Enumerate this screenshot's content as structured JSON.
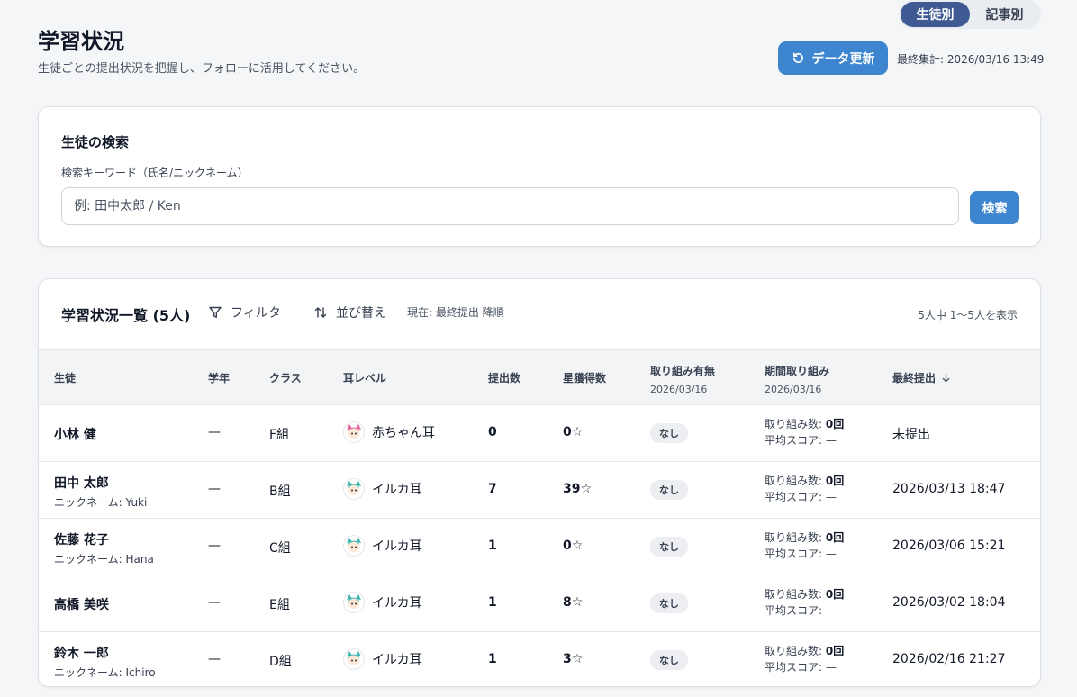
{
  "view_toggle": {
    "by_student": "生徒別",
    "by_article": "記事別",
    "active": "by_student"
  },
  "header": {
    "title": "学習状況",
    "subtitle": "生徒ごとの提出状況を把握し、フォローに活用してください。",
    "refresh_label": "データ更新",
    "last_aggregated": "最終集計: 2026/03/16 13:49"
  },
  "search": {
    "title": "生徒の検索",
    "label": "検索キーワード（氏名/ニックネーム）",
    "placeholder": "例: 田中太郎 / Ken",
    "value": "",
    "button": "検索"
  },
  "list": {
    "title": "学習状況一覧 (5人)",
    "filter_label": "フィルタ",
    "sort_label": "並び替え",
    "sort_current": "現在: 最終提出 降順",
    "count_info": "5人中 1〜5人を表示",
    "columns": {
      "student": "生徒",
      "grade": "学年",
      "class": "クラス",
      "ear_level": "耳レベル",
      "submissions": "提出数",
      "stars": "星獲得数",
      "engagement": "取り組み有無",
      "engagement_date": "2026/03/16",
      "period": "期間取り組み",
      "period_date": "2026/03/16",
      "last_submit": "最終提出"
    },
    "rows": [
      {
        "name": "小林 健",
        "nickname": "",
        "grade": "—",
        "class": "F組",
        "ear": "赤ちゃん耳",
        "ear_type": "pink",
        "submissions": "0",
        "stars": "0☆",
        "engagement": "なし",
        "act_count_label": "取り組み数:",
        "act_count": "0回",
        "avg_label": "平均スコア:",
        "avg": "—",
        "last_submit": "未提出"
      },
      {
        "name": "田中 太郎",
        "nickname": "ニックネーム: Yuki",
        "grade": "—",
        "class": "B組",
        "ear": "イルカ耳",
        "ear_type": "teal",
        "submissions": "7",
        "stars": "39☆",
        "engagement": "なし",
        "act_count_label": "取り組み数:",
        "act_count": "0回",
        "avg_label": "平均スコア:",
        "avg": "—",
        "last_submit": "2026/03/13 18:47"
      },
      {
        "name": "佐藤 花子",
        "nickname": "ニックネーム: Hana",
        "grade": "—",
        "class": "C組",
        "ear": "イルカ耳",
        "ear_type": "teal",
        "submissions": "1",
        "stars": "0☆",
        "engagement": "なし",
        "act_count_label": "取り組み数:",
        "act_count": "0回",
        "avg_label": "平均スコア:",
        "avg": "—",
        "last_submit": "2026/03/06 15:21"
      },
      {
        "name": "高橋 美咲",
        "nickname": "",
        "grade": "—",
        "class": "E組",
        "ear": "イルカ耳",
        "ear_type": "teal",
        "submissions": "1",
        "stars": "8☆",
        "engagement": "なし",
        "act_count_label": "取り組み数:",
        "act_count": "0回",
        "avg_label": "平均スコア:",
        "avg": "—",
        "last_submit": "2026/03/02 18:04"
      },
      {
        "name": "鈴木 一郎",
        "nickname": "ニックネーム: Ichiro",
        "grade": "—",
        "class": "D組",
        "ear": "イルカ耳",
        "ear_type": "teal",
        "submissions": "1",
        "stars": "3☆",
        "engagement": "なし",
        "act_count_label": "取り組み数:",
        "act_count": "0回",
        "avg_label": "平均スコア:",
        "avg": "—",
        "last_submit": "2026/02/16 21:27"
      }
    ]
  },
  "colors": {
    "primary": "#3d86cf",
    "toggle_active": "#3f5a92",
    "ear_pink": "#e8649a",
    "ear_teal": "#3fb6b0"
  },
  "icons": {
    "refresh": "refresh-icon",
    "filter": "filter-icon",
    "sort": "sort-icon",
    "sort_desc": "arrow-down-icon"
  }
}
